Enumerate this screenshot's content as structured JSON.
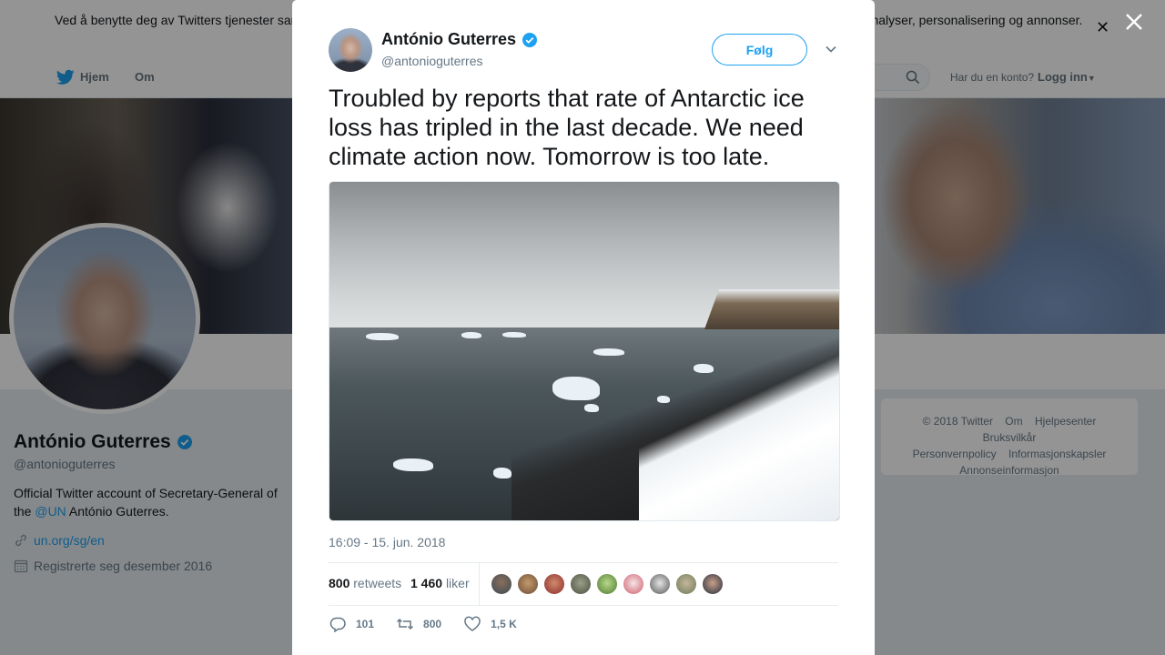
{
  "cookie_banner": {
    "text": "Ved å benytte deg av Twitters tjenester samtykker du til vår bruk av informasjonskapsler. Vi og våre partnere bruker informasjonskapsler til bl.a. analyser, personalisering og annonser.",
    "close_icon": "close-icon"
  },
  "nav": {
    "home_label": "Hjem",
    "about_label": "Om",
    "account_prompt": "Har du en konto?",
    "login_label": "Logg inn"
  },
  "profile": {
    "name": "António Guterres",
    "handle": "@antonioguterres",
    "bio_prefix": "Official Twitter account of Secretary-General of the ",
    "bio_mention": "@UN",
    "bio_suffix": " António Guterres.",
    "url": "un.org/sg/en",
    "joined": "Registrerte seg desember 2016"
  },
  "footer": {
    "items": [
      "© 2018 Twitter",
      "Om",
      "Hjelpesenter",
      "Bruksvilkår",
      "Personvernpolicy",
      "Informasjonskapsler",
      "Annonseinformasjon"
    ]
  },
  "tweet": {
    "author_name": "António Guterres",
    "author_handle": "@antonioguterres",
    "follow_label": "Følg",
    "text": "Troubled by reports that rate of Antarctic ice loss has tripled in the last decade. We need climate action now. Tomorrow is too late.",
    "timestamp": "16:09 - 15. jun. 2018",
    "retweet_count": "800",
    "retweet_label": "retweets",
    "like_count": "1 460",
    "like_label": "liker",
    "replies": "101",
    "retweets_action": "800",
    "likes_action": "1,5 K"
  },
  "colors": {
    "accent": "#1da1f2",
    "text": "#14171a",
    "muted": "#657786"
  }
}
